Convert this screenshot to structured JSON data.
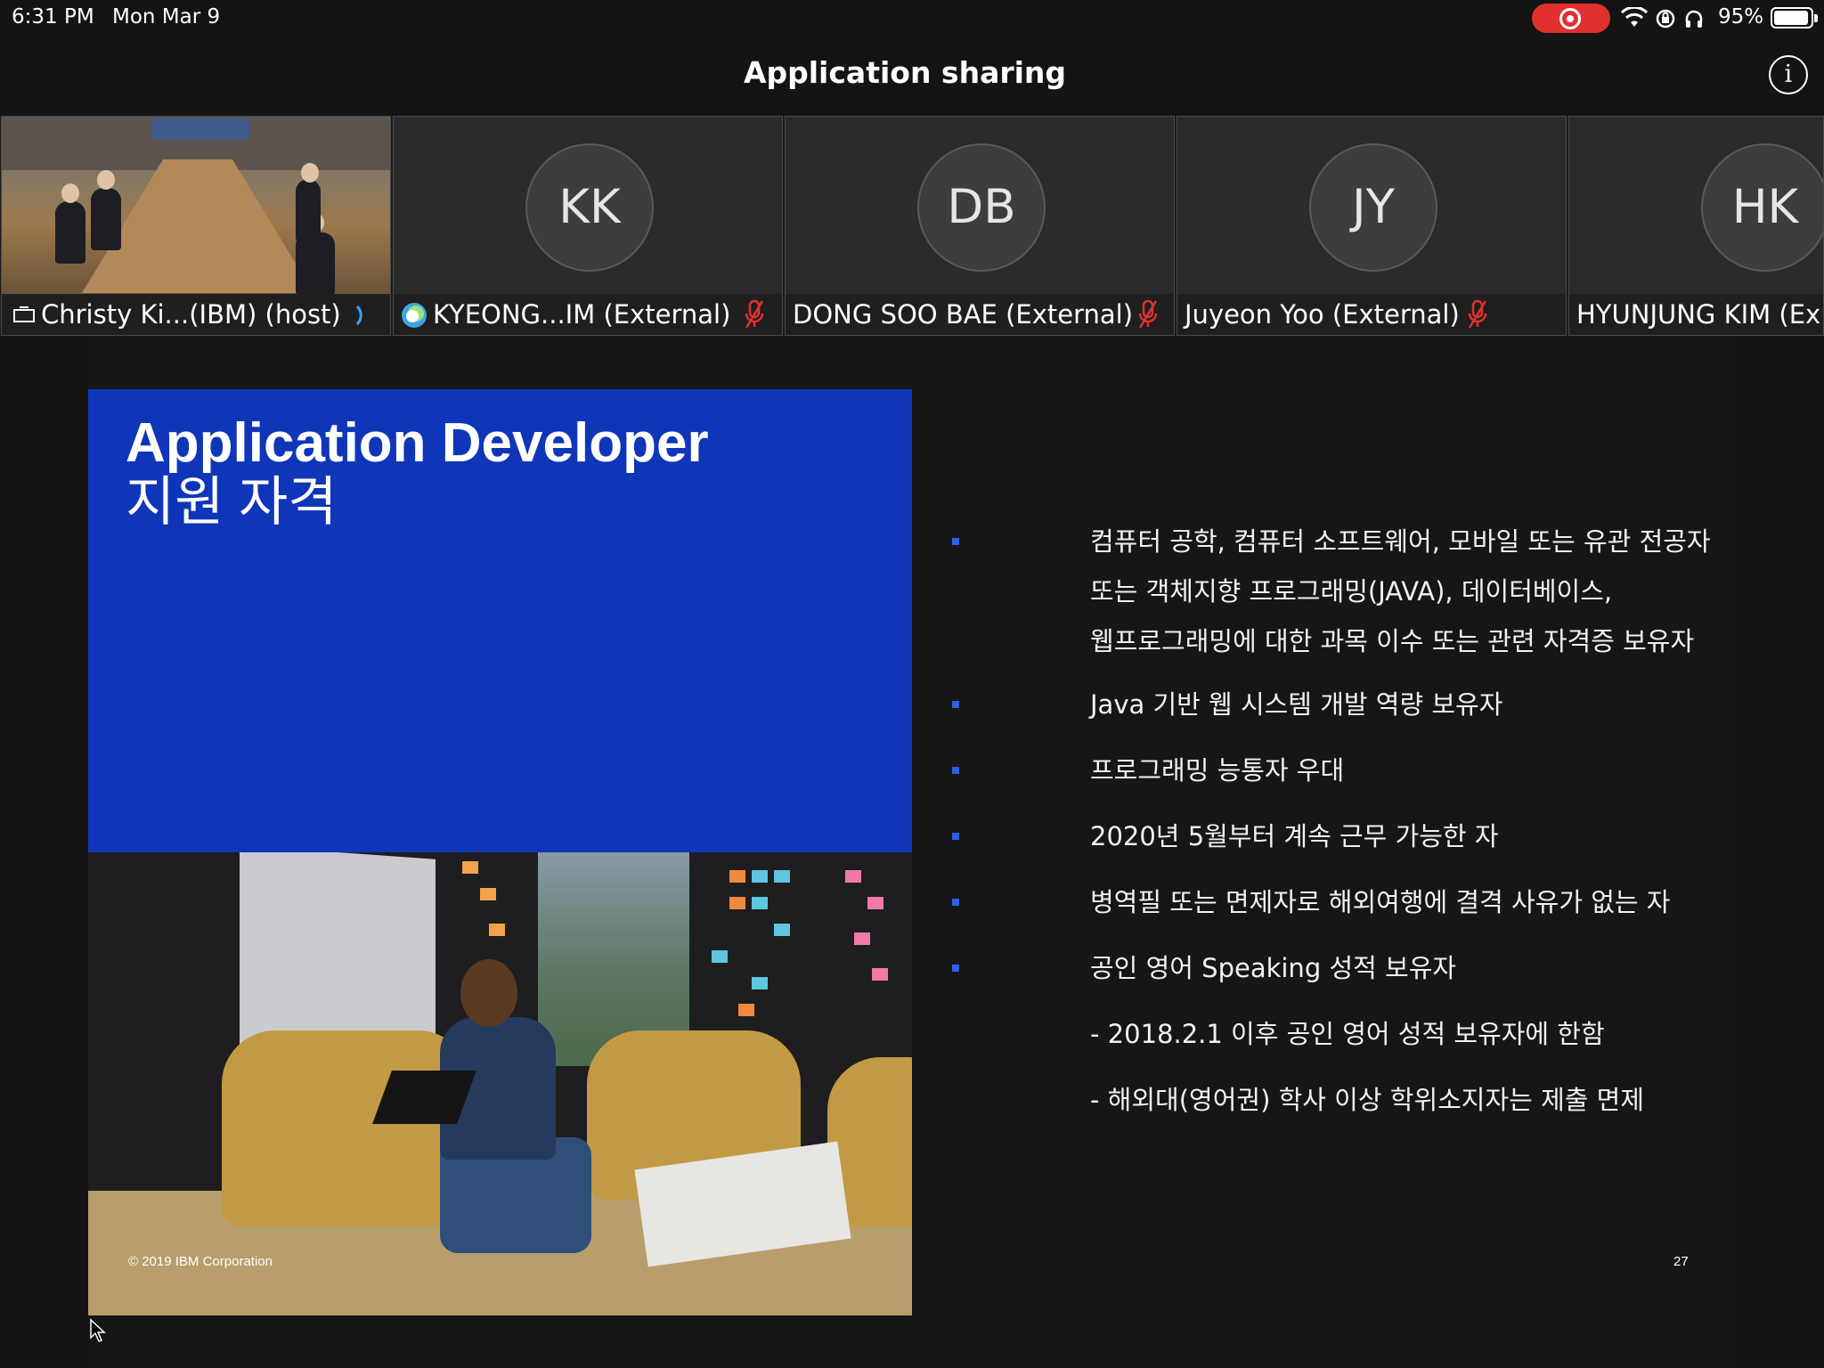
{
  "status_bar": {
    "time": "6:31 PM",
    "date": "Mon Mar 9",
    "battery_percent": "95%",
    "battery_level": 0.95,
    "icons": [
      "record-icon",
      "wifi-icon",
      "orientation-lock-icon",
      "headphones-icon",
      "battery-icon"
    ],
    "record_color": "#e0312f"
  },
  "header": {
    "title": "Application sharing",
    "info_label": "i"
  },
  "participants": [
    {
      "name": "Christy Ki...(IBM) (host)",
      "initials": "",
      "video": true,
      "icon": "screen-share-icon",
      "status_icon": "speaking-icon"
    },
    {
      "name": "KYEONG...IM (External)",
      "initials": "KK",
      "video": false,
      "icon": "app-logo-icon",
      "status_icon": "mic-muted-icon"
    },
    {
      "name": "DONG SOO BAE (External)",
      "initials": "DB",
      "video": false,
      "status_icon": "mic-muted-icon"
    },
    {
      "name": "Juyeon Yoo (External)",
      "initials": "JY",
      "video": false,
      "status_icon": "mic-muted-icon"
    },
    {
      "name": "HYUNJUNG KIM (Ex",
      "initials": "HK",
      "video": false
    }
  ],
  "slide": {
    "title": "Application Developer",
    "subtitle": "지원 자격",
    "copyright": "© 2019 IBM Corporation",
    "page_number": "27",
    "accent_color": "#0f36b8",
    "bullets": [
      {
        "lines": [
          "컴퓨터 공학, 컴퓨터 소프트웨어, 모바일 또는 유관 전공자",
          "또는 객체지향 프로그래밍(JAVA), 데이터베이스,",
          "웹프로그래밍에 대한 과목 이수 또는 관련 자격증 보유자"
        ],
        "marker": true
      },
      {
        "lines": [
          "Java 기반 웹 시스템 개발 역량 보유자"
        ],
        "marker": true
      },
      {
        "lines": [
          "프로그래밍 능통자 우대"
        ],
        "marker": true
      },
      {
        "lines": [
          "2020년 5월부터 계속 근무 가능한 자"
        ],
        "marker": true
      },
      {
        "lines": [
          "병역필 또는 면제자로 해외여행에 결격 사유가 없는 자"
        ],
        "marker": true
      },
      {
        "lines": [
          "공인 영어 Speaking 성적 보유자"
        ],
        "marker": true
      },
      {
        "lines": [
          "- 2018.2.1 이후 공인 영어 성적 보유자에 한함"
        ],
        "marker": false
      },
      {
        "lines": [
          "- 해외대(영어권) 학사 이상 학위소지자는 제출 면제"
        ],
        "marker": false
      }
    ]
  }
}
